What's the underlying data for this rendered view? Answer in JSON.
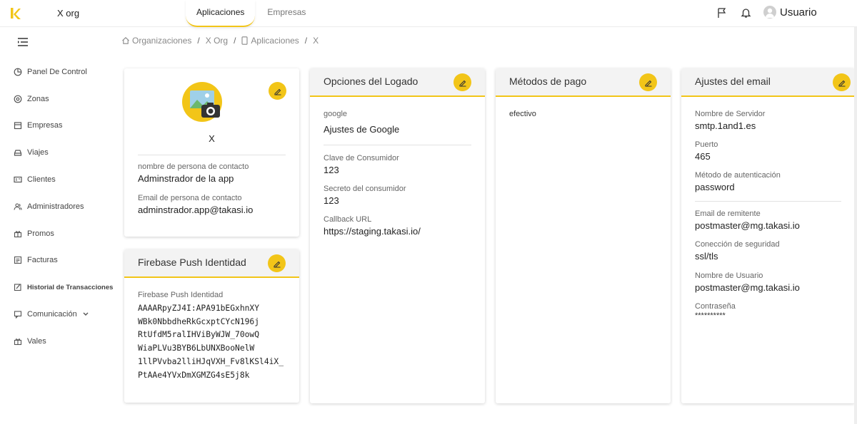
{
  "topbar": {
    "org_name": "X org",
    "tabs": [
      "Aplicaciones",
      "Empresas"
    ],
    "user_name": "Usuario"
  },
  "sidebar": {
    "items": [
      {
        "label": "Panel De Control",
        "icon": "chart-pie-icon"
      },
      {
        "label": "Zonas",
        "icon": "map-pin-icon"
      },
      {
        "label": "Empresas",
        "icon": "building-icon"
      },
      {
        "label": "Viajes",
        "icon": "car-icon"
      },
      {
        "label": "Clientes",
        "icon": "id-card-icon"
      },
      {
        "label": "Administradores",
        "icon": "users-icon"
      },
      {
        "label": "Promos",
        "icon": "gift-icon"
      },
      {
        "label": "Facturas",
        "icon": "invoice-icon"
      },
      {
        "label": "Historial de Transacciones",
        "icon": "history-icon"
      },
      {
        "label": "Comunicación",
        "icon": "chat-icon"
      },
      {
        "label": "Vales",
        "icon": "voucher-icon"
      }
    ]
  },
  "breadcrumb": {
    "organizaciones": "Organizaciones",
    "org": "X Org",
    "aplicaciones": "Aplicaciones",
    "current": "X",
    "separator": "/"
  },
  "profile_card": {
    "name": "X",
    "contact_name_label": "nombre de persona de contacto",
    "contact_name_value": "Adminstrador de la app",
    "contact_email_label": "Email de persona de contacto",
    "contact_email_value": "adminstrador.app@takasi.io"
  },
  "firebase_card": {
    "title": "Firebase Push Identidad",
    "label": "Firebase Push Identidad",
    "token_lines": [
      "AAAARpyZJ4I:APA91bEGxhnXY",
      "WBk0NbbdheRkGcxptCYcN196j",
      "RtUfdM5ralIHViByWJW_70owQ",
      "WiaPLVu3BYB6LbUNXBooNelW",
      "1llPVvba2lliHJqVXH_Fv8lKSl4iX_",
      "PtAAe4YVxDmXGMZG4sE5j8k"
    ]
  },
  "login_card": {
    "title": "Opciones del Logado",
    "provider": "google",
    "settings_title": "Ajustes de Google",
    "consumer_key_label": "Clave de Consumidor",
    "consumer_key_value": "123",
    "consumer_secret_label": "Secreto del consumidor",
    "consumer_secret_value": "123",
    "callback_label": "Callback URL",
    "callback_value": "https://staging.takasi.io/"
  },
  "payment_card": {
    "title": "Métodos de pago",
    "method": "efectivo"
  },
  "email_card": {
    "title": "Ajustes del email",
    "server_label": "Nombre de Servidor",
    "server_value": "smtp.1and1.es",
    "port_label": "Puerto",
    "port_value": "465",
    "auth_label": "Método de autenticación",
    "auth_value": "password",
    "sender_label": "Email de remitente",
    "sender_value": "postmaster@mg.takasi.io",
    "security_label": "Conección de seguridad",
    "security_value": "ssl/tls",
    "username_label": "Nombre de Usuario",
    "username_value": "postmaster@mg.takasi.io",
    "password_label": "Contraseña",
    "password_value": "**********"
  },
  "colors": {
    "accent": "#f2c518",
    "card_header": "#f3f3f3"
  }
}
